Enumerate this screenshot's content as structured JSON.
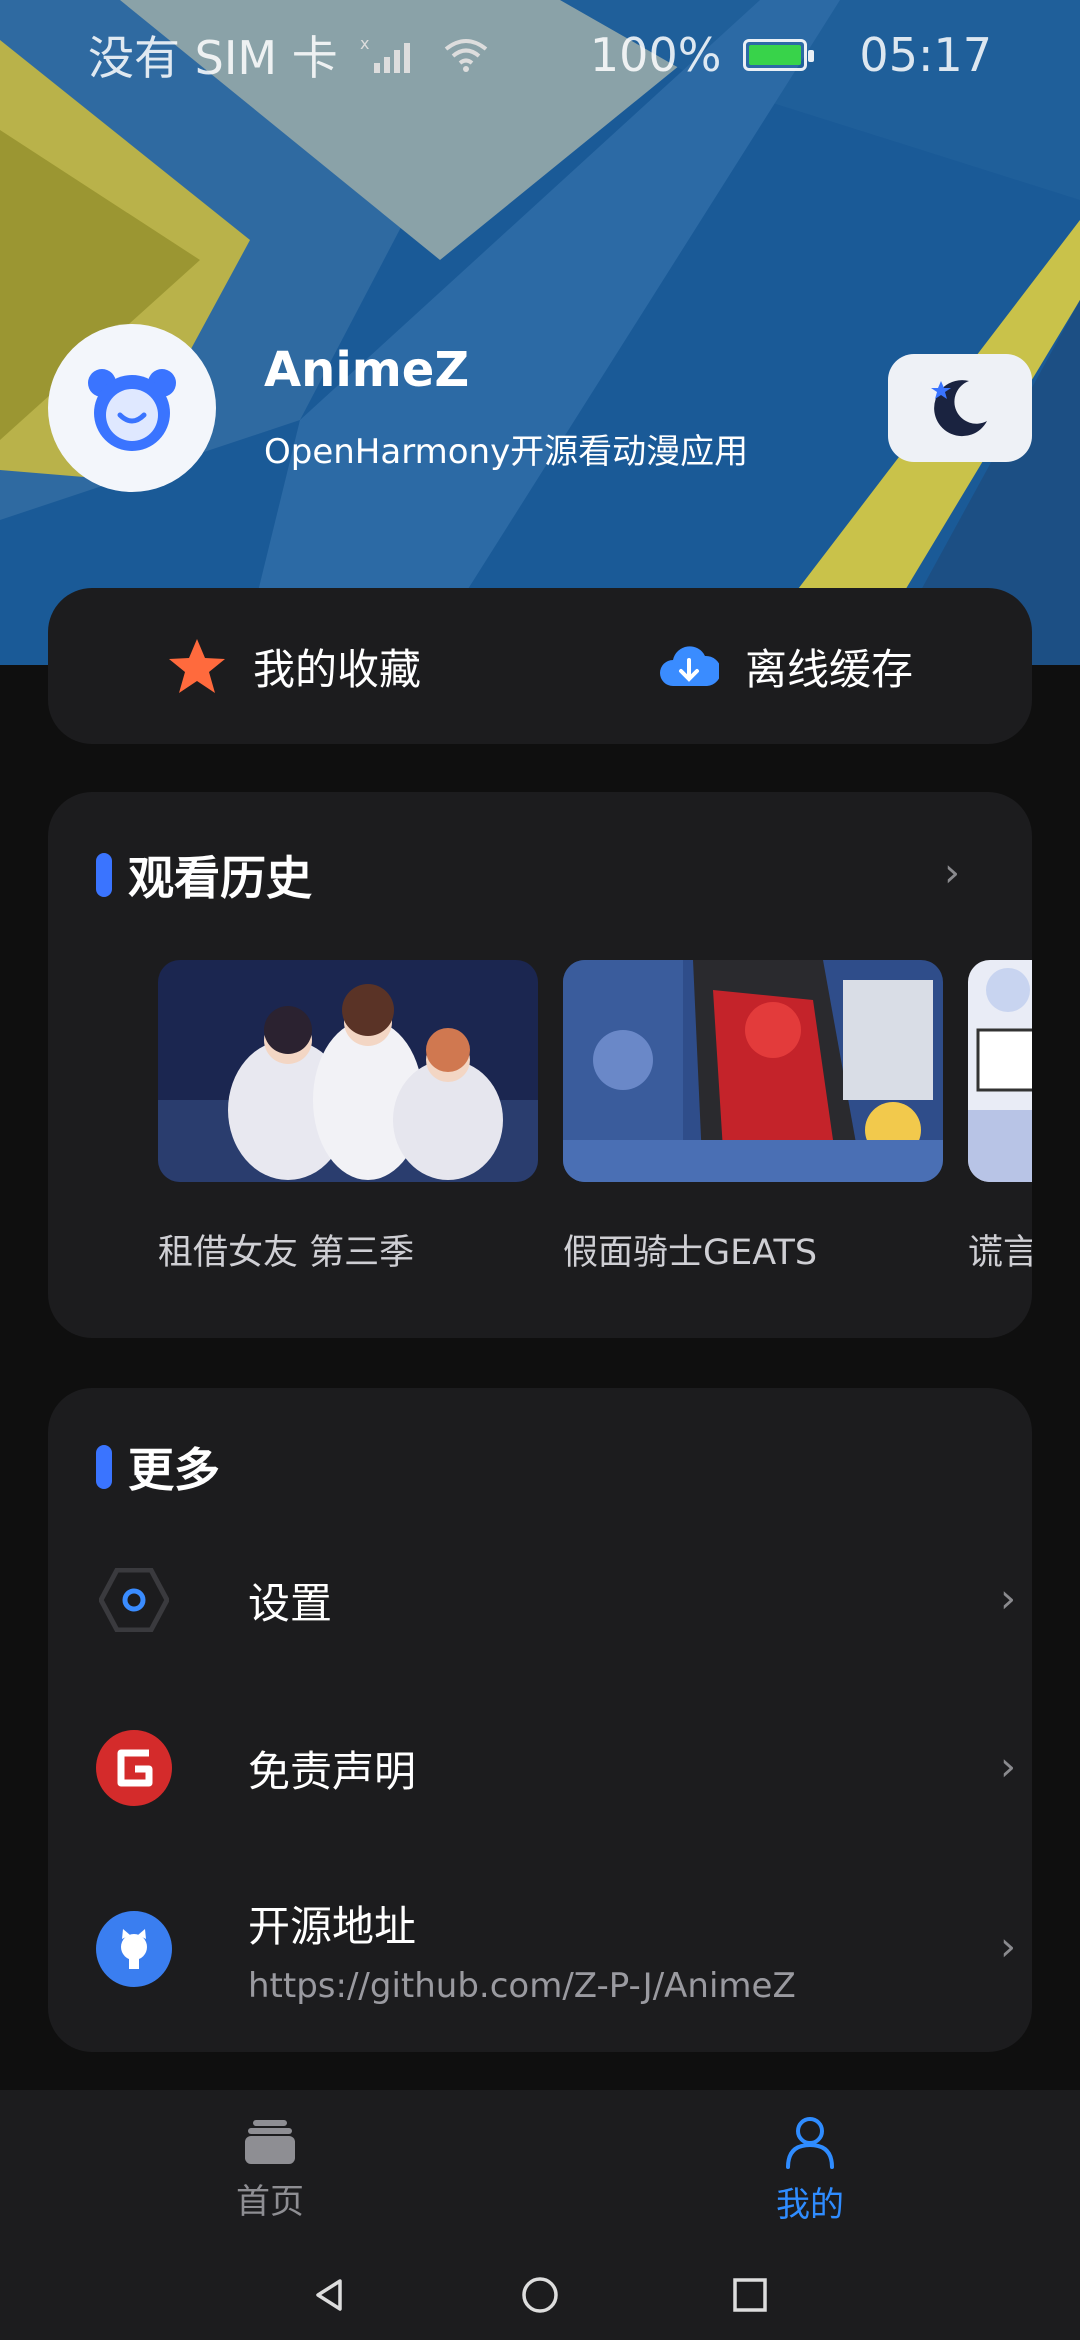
{
  "status_bar": {
    "carrier": "没有 SIM 卡",
    "battery": "100%",
    "time": "05:17"
  },
  "profile": {
    "app_name": "AnimeZ",
    "subtitle": "OpenHarmony开源看动漫应用"
  },
  "quick_actions": [
    {
      "label": "我的收藏",
      "icon": "star-icon"
    },
    {
      "label": "离线缓存",
      "icon": "cloud-download-icon"
    }
  ],
  "history": {
    "title": "观看历史",
    "items": [
      {
        "title": "租借女友 第三季"
      },
      {
        "title": "假面骑士GEATS"
      },
      {
        "title": "谎言"
      }
    ]
  },
  "more": {
    "title": "更多",
    "items": [
      {
        "label": "设置",
        "icon": "settings-hex-icon"
      },
      {
        "label": "免责声明",
        "icon": "disclaimer-g-icon"
      },
      {
        "label": "开源地址",
        "sub": "https://github.com/Z-P-J/AnimeZ",
        "icon": "github-icon"
      }
    ]
  },
  "bottom_nav": [
    {
      "label": "首页",
      "icon": "home-stack-icon",
      "active": false
    },
    {
      "label": "我的",
      "icon": "person-icon",
      "active": true
    }
  ],
  "colors": {
    "accent": "#2f8cff",
    "section_bar": "#3a74ff",
    "card_bg": "#1c1c1e",
    "page_bg": "#0f0f0f"
  }
}
